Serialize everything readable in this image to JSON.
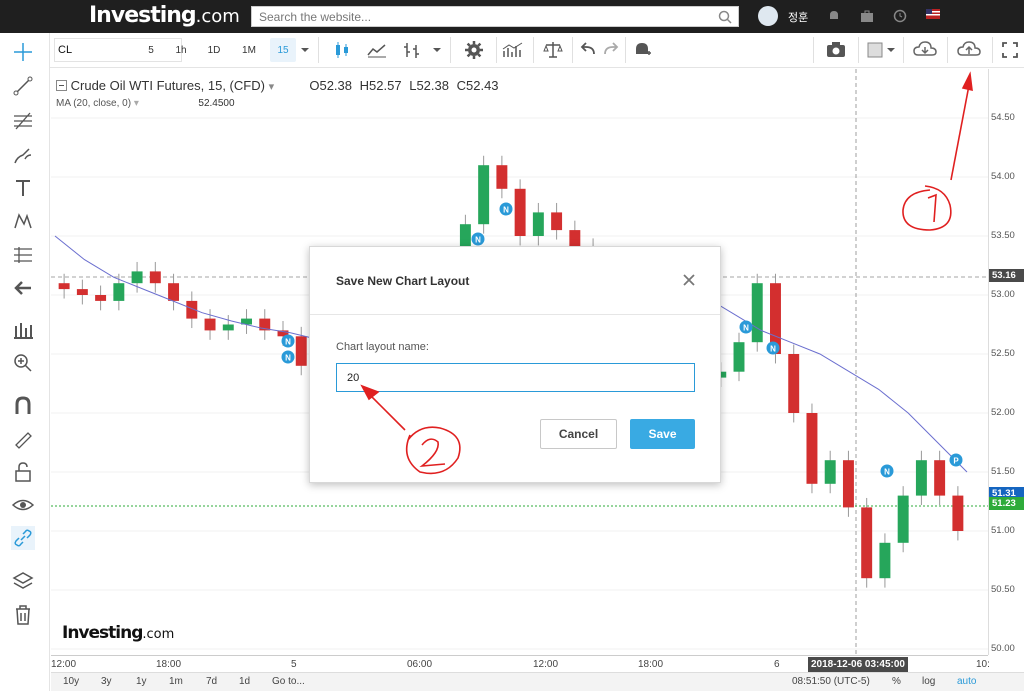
{
  "site": {
    "logo_main": "Investing",
    "logo_suffix": ".com",
    "search_placeholder": "Search the website...",
    "username": "정훈"
  },
  "toolbar": {
    "symbol": "CL",
    "intervals": [
      "5",
      "1h",
      "1D",
      "1M",
      "15"
    ],
    "active_interval": "15"
  },
  "legend": {
    "title": "Crude Oil WTI Futures, 15, (CFD)",
    "o_label": "O",
    "o": "52.38",
    "h_label": "H",
    "h": "52.57",
    "l_label": "L",
    "l": "52.38",
    "c_label": "C",
    "c": "52.43",
    "ma_label": "MA (20, close, 0)",
    "ma_value": "52.4500"
  },
  "price_axis": {
    "labels": [
      "54.50",
      "54.00",
      "53.50",
      "53.00",
      "52.50",
      "52.00",
      "51.50",
      "51.00",
      "50.50",
      "50.00"
    ],
    "crosshair_price": "53.16",
    "last_price_red": "51.31",
    "last_price_green": "51.23"
  },
  "time_axis": {
    "labels": [
      "12:00",
      "18:00",
      "5",
      "06:00",
      "12:00",
      "18:00",
      "6",
      "10:"
    ],
    "crosshair_time": "2018-12-06 03:45:00"
  },
  "bottom_bar": {
    "ranges": [
      "10y",
      "3y",
      "1y",
      "1m",
      "7d",
      "1d"
    ],
    "goto": "Go to...",
    "clock": "08:51:50 (UTC-5)",
    "percent": "%",
    "log": "log",
    "auto": "auto"
  },
  "dialog": {
    "title": "Save New Chart Layout",
    "field_label": "Chart layout name:",
    "field_value": "20",
    "cancel_label": "Cancel",
    "save_label": "Save"
  },
  "chart_markers": {
    "news": "N",
    "p": "P"
  },
  "colors": {
    "up": "#26a65b",
    "down": "#d32f2f",
    "ma": "#6b6fcf",
    "accent": "#2a9ad8",
    "annotation": "#e02020"
  },
  "chart_data": {
    "type": "candlestick",
    "title": "Crude Oil WTI Futures, 15, (CFD)",
    "ylim": [
      50.0,
      54.5
    ],
    "x_ticks": [
      "12:00",
      "18:00",
      "5",
      "06:00",
      "12:00",
      "18:00",
      "6",
      "10:"
    ],
    "series": [
      {
        "name": "Crude Oil WTI Futures",
        "values": [
          53.05,
          53.0,
          52.95,
          53.1,
          53.2,
          53.1,
          52.95,
          52.8,
          52.7,
          52.75,
          52.8,
          52.7,
          52.65,
          52.4,
          52.2,
          52.3,
          52.35,
          52.45,
          52.5,
          52.6,
          52.9,
          53.2,
          53.6,
          54.1,
          53.9,
          53.5,
          53.7,
          53.55,
          53.4,
          53.2,
          52.9,
          52.7,
          52.6,
          52.45,
          52.4,
          52.3,
          52.35,
          52.6,
          53.1,
          52.5,
          52.0,
          51.4,
          51.6,
          51.2,
          50.6,
          50.9,
          51.3,
          51.6,
          51.3,
          51.0
        ]
      },
      {
        "name": "MA (20, close, 0)",
        "values": [
          53.5,
          53.3,
          53.15,
          53.05,
          52.95,
          52.85,
          52.78,
          52.72,
          52.68,
          52.62,
          52.55,
          52.5,
          52.45,
          52.42,
          52.45,
          52.6,
          52.9,
          53.15,
          53.3,
          53.4,
          53.35,
          53.2,
          53.0,
          52.85,
          52.7,
          52.6,
          52.5,
          52.35,
          52.2,
          52.0,
          51.75,
          51.5
        ]
      }
    ]
  }
}
